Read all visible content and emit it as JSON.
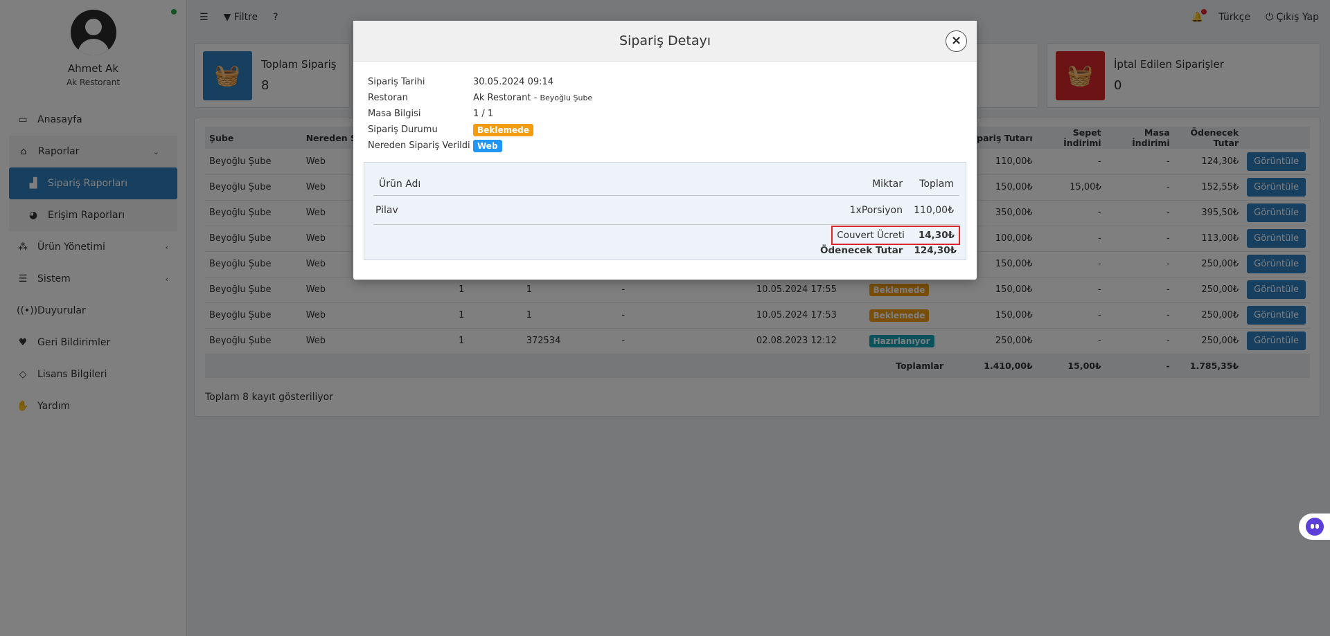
{
  "sidebar": {
    "user_name": "Ahmet Ak",
    "restaurant": "Ak Restorant",
    "items": [
      {
        "label": "Anasayfa"
      },
      {
        "label": "Raporlar"
      },
      {
        "label": "Sipariş Raporları"
      },
      {
        "label": "Erişim Raporları"
      },
      {
        "label": "Ürün Yönetimi"
      },
      {
        "label": "Sistem"
      },
      {
        "label": "Duyurular"
      },
      {
        "label": "Geri Bildirimler"
      },
      {
        "label": "Lisans Bilgileri"
      },
      {
        "label": "Yardım"
      }
    ]
  },
  "topbar": {
    "filter_label": "Filtre",
    "language": "Türkçe",
    "logout": "Çıkış Yap"
  },
  "cards": {
    "total": {
      "title": "Toplam Sipariş",
      "value": "8",
      "color": "#2d7fc1"
    },
    "cancelled": {
      "title": "İptal Edilen Siparişler",
      "value": "0",
      "color": "#d9262c"
    }
  },
  "table": {
    "headers": {
      "branch": "Şube",
      "source": "Nereden Si",
      "order_total": "Sipariş Tutarı",
      "basket_discount": "Sepet İndirimi",
      "table_discount": "Masa İndirimi",
      "payable": "Ödenecek Tutar"
    },
    "rows": [
      {
        "branch": "Beyoğlu Şube",
        "source": "Web",
        "c1": "",
        "c2": "",
        "c3": "",
        "date": "",
        "status": "",
        "total": "110,00₺",
        "basket": "-",
        "table": "-",
        "payable": "124,30₺"
      },
      {
        "branch": "Beyoğlu Şube",
        "source": "Web",
        "c1": "",
        "c2": "",
        "c3": "",
        "date": "",
        "status": "",
        "total": "150,00₺",
        "basket": "15,00₺",
        "table": "-",
        "payable": "152,55₺"
      },
      {
        "branch": "Beyoğlu Şube",
        "source": "Web",
        "c1": "",
        "c2": "",
        "c3": "",
        "date": "",
        "status": "",
        "total": "350,00₺",
        "basket": "-",
        "table": "-",
        "payable": "395,50₺"
      },
      {
        "branch": "Beyoğlu Şube",
        "source": "Web",
        "c1": "",
        "c2": "",
        "c3": "",
        "date": "",
        "status": "",
        "total": "100,00₺",
        "basket": "-",
        "table": "-",
        "payable": "113,00₺"
      },
      {
        "branch": "Beyoğlu Şube",
        "source": "Web",
        "c1": "",
        "c2": "",
        "c3": "",
        "date": "",
        "status": "",
        "total": "150,00₺",
        "basket": "-",
        "table": "-",
        "payable": "250,00₺"
      },
      {
        "branch": "Beyoğlu Şube",
        "source": "Web",
        "c1": "1",
        "c2": "1",
        "c3": "-",
        "date": "10.05.2024 17:55",
        "status": "Beklemede",
        "total": "150,00₺",
        "basket": "-",
        "table": "-",
        "payable": "250,00₺"
      },
      {
        "branch": "Beyoğlu Şube",
        "source": "Web",
        "c1": "1",
        "c2": "1",
        "c3": "-",
        "date": "10.05.2024 17:53",
        "status": "Beklemede",
        "total": "150,00₺",
        "basket": "-",
        "table": "-",
        "payable": "250,00₺"
      },
      {
        "branch": "Beyoğlu Şube",
        "source": "Web",
        "c1": "1",
        "c2": "372534",
        "c3": "-",
        "date": "02.08.2023 12:12",
        "status": "Hazırlanıyor",
        "total": "250,00₺",
        "basket": "-",
        "table": "-",
        "payable": "250,00₺"
      }
    ],
    "view_button": "Görüntüle",
    "totals": {
      "label": "Toplamlar",
      "total": "1.410,00₺",
      "basket": "15,00₺",
      "table": "-",
      "payable": "1.785,35₺"
    },
    "footer_text": "Toplam 8 kayıt gösteriliyor"
  },
  "modal": {
    "title": "Sipariş Detayı",
    "close": "×",
    "labels": {
      "date": "Sipariş Tarihi",
      "restaurant": "Restoran",
      "table": "Masa Bilgisi",
      "status": "Sipariş Durumu",
      "source": "Nereden Sipariş Verildi"
    },
    "values": {
      "date": "30.05.2024 09:14",
      "restaurant": "Ak Restorant -",
      "branch": "Beyoğlu Şube",
      "table": "1 / 1",
      "status": "Beklemede",
      "source": "Web"
    },
    "items_header": {
      "name": "Ürün Adı",
      "qty": "Miktar",
      "total": "Toplam"
    },
    "items": [
      {
        "name": "Pilav",
        "qty": "1xPorsiyon",
        "total": "110,00₺"
      }
    ],
    "couvert_label": "Couvert Ücreti",
    "couvert_value": "14,30₺",
    "payable_label": "Ödenecek Tutar",
    "payable_value": "124,30₺"
  }
}
